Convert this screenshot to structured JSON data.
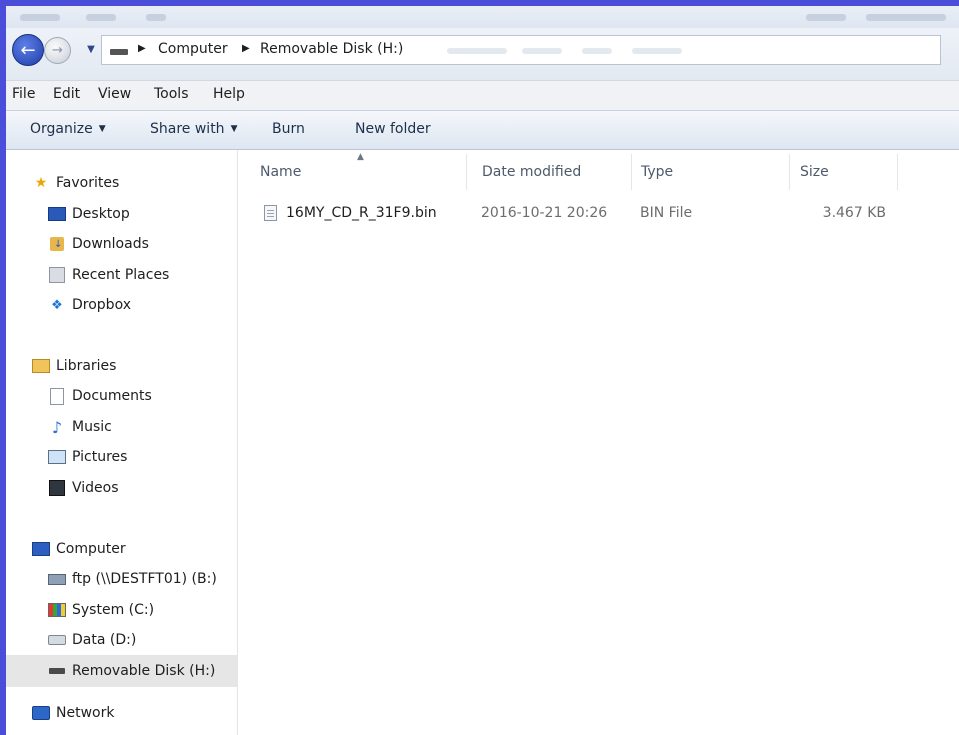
{
  "address_bar": {
    "crumbs": [
      "Computer",
      "Removable Disk (H:)"
    ]
  },
  "menu": [
    "File",
    "Edit",
    "View",
    "Tools",
    "Help"
  ],
  "commands": {
    "organize": "Organize",
    "share_with": "Share with",
    "burn": "Burn",
    "new_folder": "New folder"
  },
  "nav": {
    "favorites": {
      "label": "Favorites",
      "items": [
        "Desktop",
        "Downloads",
        "Recent Places",
        "Dropbox"
      ]
    },
    "libraries": {
      "label": "Libraries",
      "items": [
        "Documents",
        "Music",
        "Pictures",
        "Videos"
      ]
    },
    "computer": {
      "label": "Computer",
      "items": [
        "ftp (\\\\DESTFT01) (B:)",
        "System (C:)",
        "Data (D:)",
        "Removable Disk (H:)"
      ]
    },
    "network": {
      "label": "Network"
    }
  },
  "columns": {
    "name": "Name",
    "date_modified": "Date modified",
    "type": "Type",
    "size": "Size"
  },
  "files": [
    {
      "name": "16MY_CD_R_31F9.bin",
      "date_modified": "2016-10-21 20:26",
      "type": "BIN File",
      "size": "3.467 KB"
    }
  ],
  "colors": {
    "window_border": "#4a4ed8",
    "back_button": "#1d3da8",
    "selected_nav": "#e6e6e6"
  }
}
